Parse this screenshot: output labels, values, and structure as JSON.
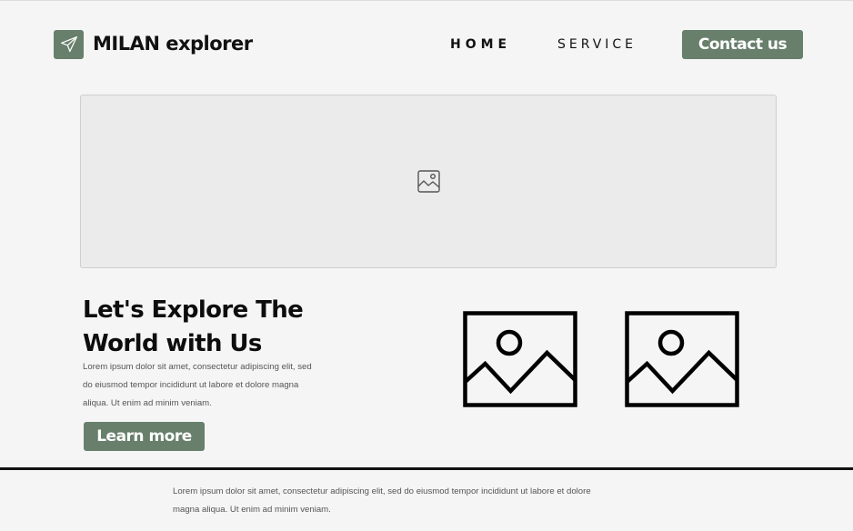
{
  "header": {
    "brand": "MILAN explorer",
    "logo_icon": "paper-plane-icon",
    "nav": {
      "home": "HOME",
      "service": "SERVICE"
    },
    "contact_label": "Contact us"
  },
  "hero": {
    "image_icon": "image-icon"
  },
  "content": {
    "title": "Let's Explore The World with Us",
    "body": "Lorem ipsum dolor sit amet, consectetur adipiscing elit, sed do eiusmod tempor incididunt ut labore et dolore magna aliqua. Ut enim ad minim veniam.",
    "button_label": "Learn more",
    "gallery_icons": [
      "image-icon",
      "image-icon"
    ]
  },
  "footer": {
    "text": "Lorem ipsum dolor sit amet, consectetur adipiscing elit, sed do eiusmod tempor incididunt ut labore et dolore magna aliqua. Ut enim ad minim veniam."
  },
  "colors": {
    "accent": "#677f6b",
    "background": "#f5f5f5",
    "hero_bg": "#ebebeb"
  }
}
